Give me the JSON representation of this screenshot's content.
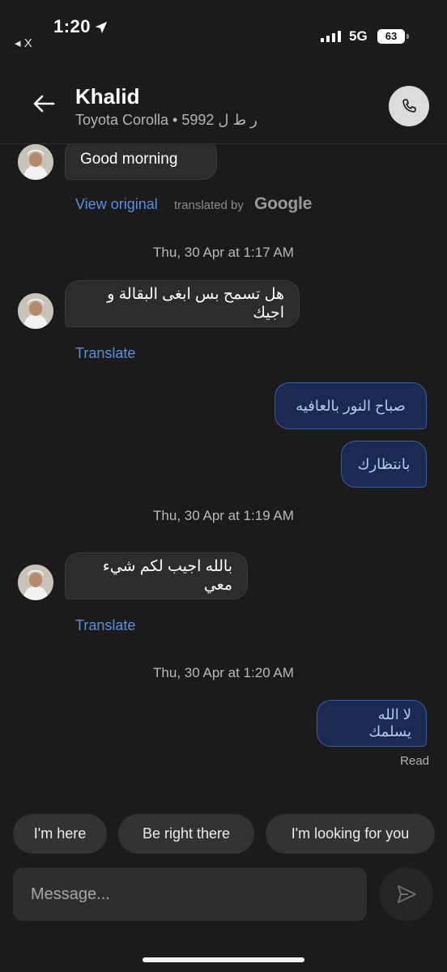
{
  "status_bar": {
    "back_app": "◂ X",
    "time": "1:20",
    "network": "5G",
    "battery": "63"
  },
  "header": {
    "name": "Khalid",
    "car": "Toyota Corolla • 5992 ر ط ل"
  },
  "messages": {
    "m1": {
      "text": "Good morning",
      "view_original": "View original",
      "translated_by": "translated by",
      "google": "Google"
    },
    "ts1": "Thu, 30 Apr at 1:17 AM",
    "m2": {
      "text": "هل تسمح بس ابغى البقالة و اجيك",
      "translate": "Translate"
    },
    "m3": {
      "text": "صباح النور بالعافيه"
    },
    "m4": {
      "text": "بانتظارك"
    },
    "ts2": "Thu, 30 Apr at 1:19 AM",
    "m5": {
      "text": "بالله اجيب لكم شيء معي",
      "translate": "Translate"
    },
    "ts3": "Thu, 30 Apr at 1:20 AM",
    "m6": {
      "text": "لا الله يسلمك",
      "status": "Read"
    }
  },
  "quick_replies": [
    "I'm here",
    "Be right there",
    "I'm looking for you"
  ],
  "composer": {
    "placeholder": "Message..."
  },
  "colors": {
    "background": "#1b1b1b",
    "incoming_bubble": "#2c2c2c",
    "outgoing_bubble": "#1a2a52",
    "link": "#5a8fe0"
  }
}
